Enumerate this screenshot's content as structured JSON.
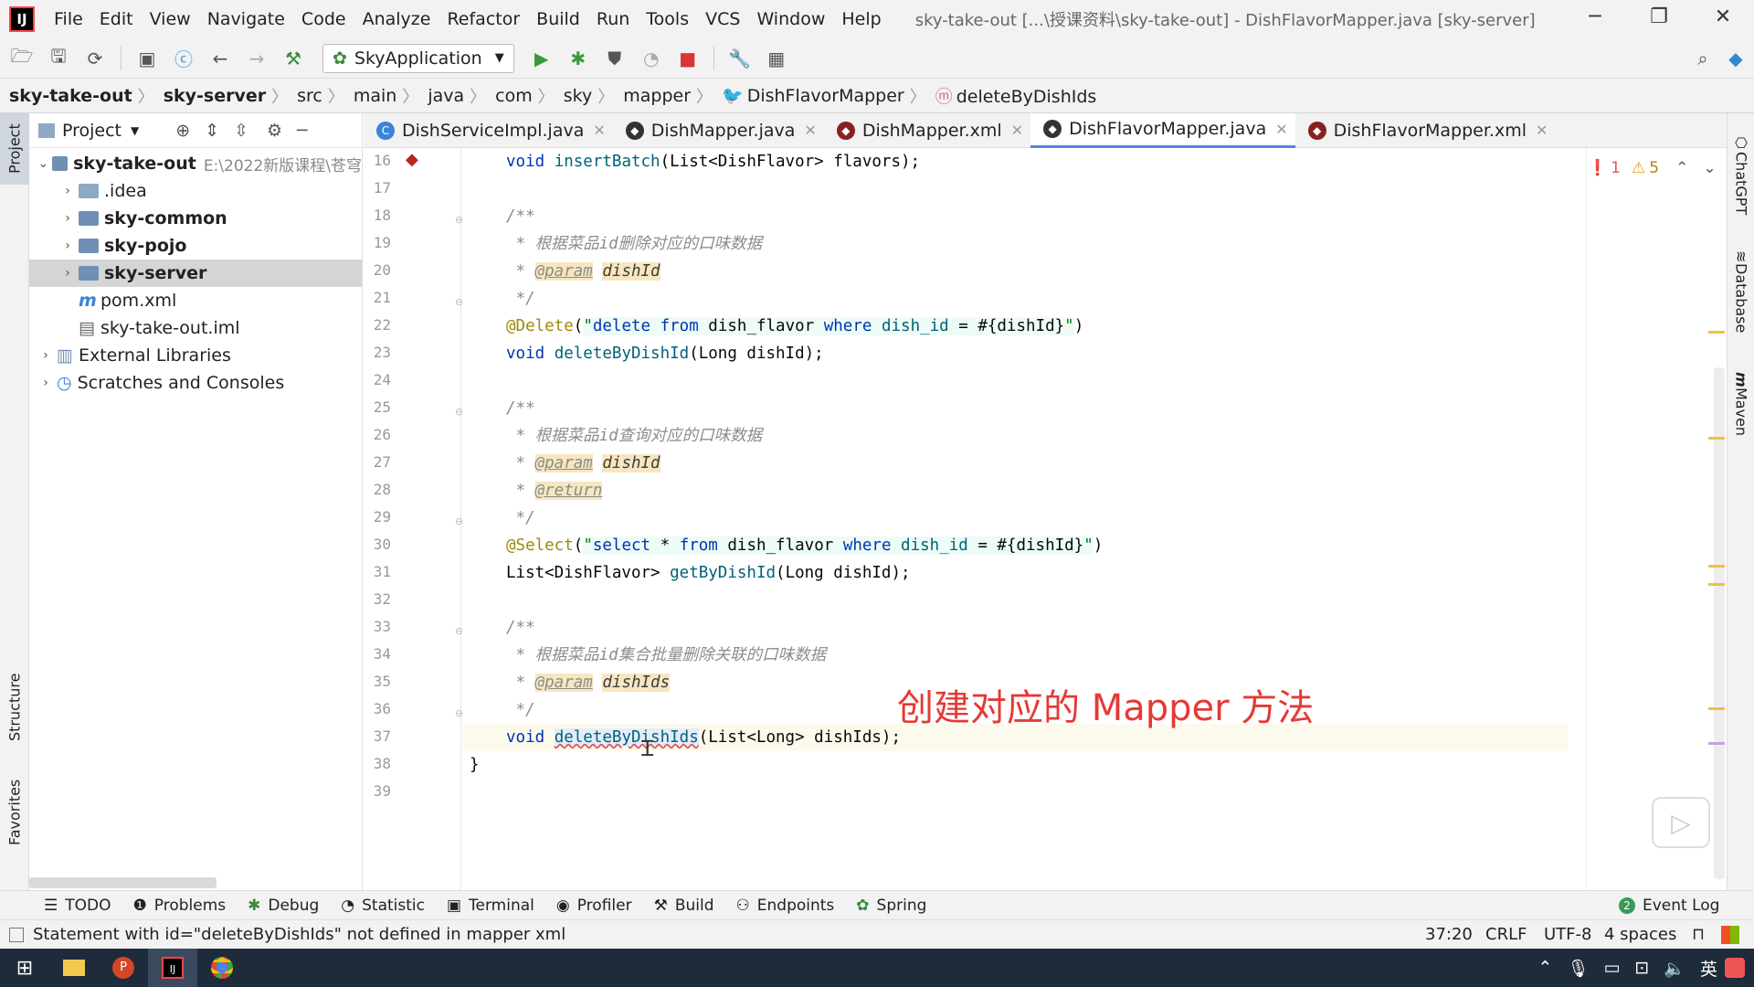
{
  "menubar": {
    "logo": "IJ",
    "items": [
      "File",
      "Edit",
      "View",
      "Navigate",
      "Code",
      "Analyze",
      "Refactor",
      "Build",
      "Run",
      "Tools",
      "VCS",
      "Window",
      "Help"
    ],
    "title": "sky-take-out [...\\授课资料\\sky-take-out] - DishFlavorMapper.java [sky-server]"
  },
  "toolbar": {
    "run_config": "SkyApplication"
  },
  "breadcrumbs": [
    "sky-take-out",
    "sky-server",
    "src",
    "main",
    "java",
    "com",
    "sky",
    "mapper",
    "DishFlavorMapper",
    "deleteByDishIds"
  ],
  "left_tabs": {
    "project": "Project",
    "structure": "Structure",
    "favorites": "Favorites"
  },
  "project": {
    "header": "Project",
    "root": {
      "name": "sky-take-out",
      "path": "E:\\2022新版课程\\苍穹"
    },
    "items": [
      {
        "label": ".idea"
      },
      {
        "label": "sky-common"
      },
      {
        "label": "sky-pojo"
      },
      {
        "label": "sky-server"
      },
      {
        "label": "pom.xml"
      },
      {
        "label": "sky-take-out.iml"
      },
      {
        "label": "External Libraries"
      },
      {
        "label": "Scratches and Consoles"
      }
    ]
  },
  "tabs": [
    {
      "label": "DishServiceImpl.java"
    },
    {
      "label": "DishMapper.java"
    },
    {
      "label": "DishMapper.xml"
    },
    {
      "label": "DishFlavorMapper.java"
    },
    {
      "label": "DishFlavorMapper.xml"
    }
  ],
  "inspections": {
    "errors": "1",
    "warnings": "5"
  },
  "line_numbers": [
    "16",
    "17",
    "18",
    "19",
    "20",
    "21",
    "22",
    "23",
    "24",
    "25",
    "26",
    "27",
    "28",
    "29",
    "30",
    "31",
    "32",
    "33",
    "34",
    "35",
    "36",
    "37",
    "38",
    "39"
  ],
  "code": {
    "l16_void": "void ",
    "l16_fn": "insertBatch",
    "l16_rest": "(List<DishFlavor> flavors);",
    "l18": "/**",
    "l19": " * 根据菜品id删除对应的口味数据",
    "l20_star": " * ",
    "l20_tag": "@param",
    "l20_sp": " ",
    "l20_p": "dishId",
    "l21": " */",
    "l22_ann": "@Delete",
    "l22_p1": "(",
    "l22_q1": "\"",
    "l22_k1": "delete from",
    "l22_t1": " dish_flavor ",
    "l22_k2": "where",
    "l22_t2": " dish_id ",
    "l22_t3": "= #{dishId}",
    "l22_q2": "\"",
    "l22_p2": ")",
    "l23_void": "void ",
    "l23_fn": "deleteByDishId",
    "l23_rest": "(Long dishId);",
    "l25": "/**",
    "l26": " * 根据菜品id查询对应的口味数据",
    "l27_star": " * ",
    "l27_tag": "@param",
    "l27_sp": " ",
    "l27_p": "dishId",
    "l28_star": " * ",
    "l28_tag": "@return",
    "l29": " */",
    "l30_ann": "@Select",
    "l30_p1": "(",
    "l30_q1": "\"",
    "l30_k1": "select",
    "l30_t1": " * ",
    "l30_k2": "from",
    "l30_t2": " dish_flavor ",
    "l30_k3": "where",
    "l30_t3": " dish_id ",
    "l30_t4": "= #{dishId}",
    "l30_q2": "\"",
    "l30_p2": ")",
    "l31_type": "List<DishFlavor> ",
    "l31_fn": "getByDishId",
    "l31_rest": "(Long dishId);",
    "l33": "/**",
    "l34": " * 根据菜品id集合批量删除关联的口味数据",
    "l35_star": " * ",
    "l35_tag": "@param",
    "l35_sp": " ",
    "l35_p": "dishIds",
    "l36": " */",
    "l37_void": "void ",
    "l37_fn": "deleteByDishIds",
    "l37_rest": "(List<Long> dishIds);",
    "l38": "}"
  },
  "overlay_caption": "创建对应的 Mapper 方法",
  "right_tabs": {
    "chatgpt": "ChatGPT",
    "database": "Database",
    "maven": "Maven"
  },
  "toolwindows": [
    "TODO",
    "Problems",
    "Debug",
    "Statistic",
    "Terminal",
    "Profiler",
    "Build",
    "Endpoints",
    "Spring"
  ],
  "event_log": {
    "count": "2",
    "label": "Event Log"
  },
  "status": {
    "message": "Statement with id=\"deleteByDishIds\" not defined in mapper xml",
    "position": "37:20",
    "line_sep": "CRLF",
    "encoding": "UTF-8",
    "indent": "4 spaces"
  },
  "taskbar": {
    "ime": "英"
  },
  "colors": {
    "accent": "#4a86e8",
    "error": "#e05555",
    "caption": "#e53935"
  }
}
